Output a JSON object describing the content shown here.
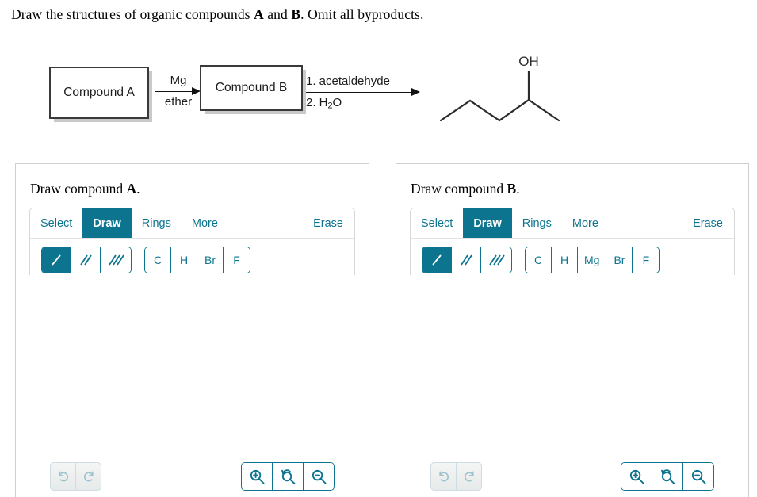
{
  "prompt": {
    "before": "Draw the structures of organic compounds ",
    "bold_a": "A",
    "middle": " and ",
    "bold_b": "B",
    "after": ". Omit all byproducts."
  },
  "scheme": {
    "box_a_label": "Compound A",
    "box_b_label": "Compound B",
    "arrow1": {
      "above": "Mg",
      "below": "ether"
    },
    "arrow2": {
      "above": "1. acetaldehyde",
      "below_prefix": "2. H",
      "below_sub": "2",
      "below_suffix": "O"
    },
    "product": {
      "oh_label": "OH",
      "name": "pentan-2-ol-skeletal"
    }
  },
  "panel_a": {
    "title_prefix": "Draw compound ",
    "title_bold": "A",
    "title_suffix": ".",
    "tabs": [
      {
        "label": "Select",
        "active": false
      },
      {
        "label": "Draw",
        "active": true
      },
      {
        "label": "Rings",
        "active": false
      },
      {
        "label": "More",
        "active": false
      }
    ],
    "erase_label": "Erase",
    "bond_buttons": [
      {
        "name": "single-bond",
        "active": true
      },
      {
        "name": "double-bond",
        "active": false
      },
      {
        "name": "triple-bond",
        "active": false
      }
    ],
    "element_buttons": [
      "C",
      "H",
      "Br",
      "F"
    ],
    "history_buttons": [
      "undo",
      "redo"
    ],
    "zoom_buttons": [
      "zoom-in",
      "zoom-reset",
      "zoom-out"
    ]
  },
  "panel_b": {
    "title_prefix": "Draw compound ",
    "title_bold": "B",
    "title_suffix": ".",
    "tabs": [
      {
        "label": "Select",
        "active": false
      },
      {
        "label": "Draw",
        "active": true
      },
      {
        "label": "Rings",
        "active": false
      },
      {
        "label": "More",
        "active": false
      }
    ],
    "erase_label": "Erase",
    "bond_buttons": [
      {
        "name": "single-bond",
        "active": true
      },
      {
        "name": "double-bond",
        "active": false
      },
      {
        "name": "triple-bond",
        "active": false
      }
    ],
    "element_buttons": [
      "C",
      "H",
      "Mg",
      "Br",
      "F"
    ],
    "history_buttons": [
      "undo",
      "redo"
    ],
    "zoom_buttons": [
      "zoom-in",
      "zoom-reset",
      "zoom-out"
    ]
  },
  "colors": {
    "accent": "#0d7490",
    "panel_border": "#cfcfcf",
    "disabled_icon": "#9dc4cf",
    "structure_line": "#2b2b2b"
  }
}
